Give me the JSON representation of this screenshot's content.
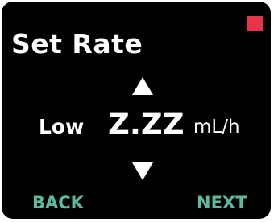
{
  "screen": {
    "title": "Set Rate",
    "rate_limit_label": "Low",
    "rate_value": "Z.ZZ",
    "rate_unit": "mL/h",
    "status_indicator_color": "#e8334a"
  },
  "controls": {
    "increase_icon": "up-triangle",
    "decrease_icon": "down-triangle"
  },
  "softkeys": {
    "back_label": "BACK",
    "next_label": "NEXT",
    "color": "#5fb8a0"
  }
}
